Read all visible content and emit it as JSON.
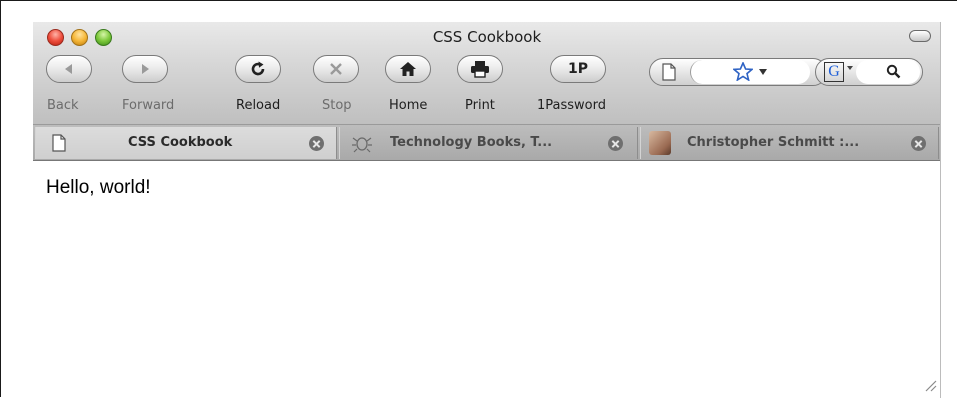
{
  "window": {
    "title": "CSS Cookbook"
  },
  "toolbar": {
    "back_label": "Back",
    "forward_label": "Forward",
    "reload_label": "Reload",
    "stop_label": "Stop",
    "home_label": "Home",
    "print_label": "Print",
    "onepassword_label": "1Password",
    "onepassword_glyph": "1P"
  },
  "search": {
    "engine_glyph": "G"
  },
  "tabs": [
    {
      "title": "CSS Cookbook",
      "active": true,
      "icon": "blank-page-icon"
    },
    {
      "title": "Technology Books, T...",
      "active": false,
      "icon": "bug-icon"
    },
    {
      "title": "Christopher Schmitt :...",
      "active": false,
      "icon": "face-thumbnail-icon"
    }
  ],
  "content": {
    "text": "Hello, world!"
  },
  "colors": {
    "close": "#ee4f3e",
    "minimize": "#f6b83a",
    "zoom": "#7ec93c",
    "star": "#2f63c4",
    "google_blue": "#1e5fd8"
  }
}
